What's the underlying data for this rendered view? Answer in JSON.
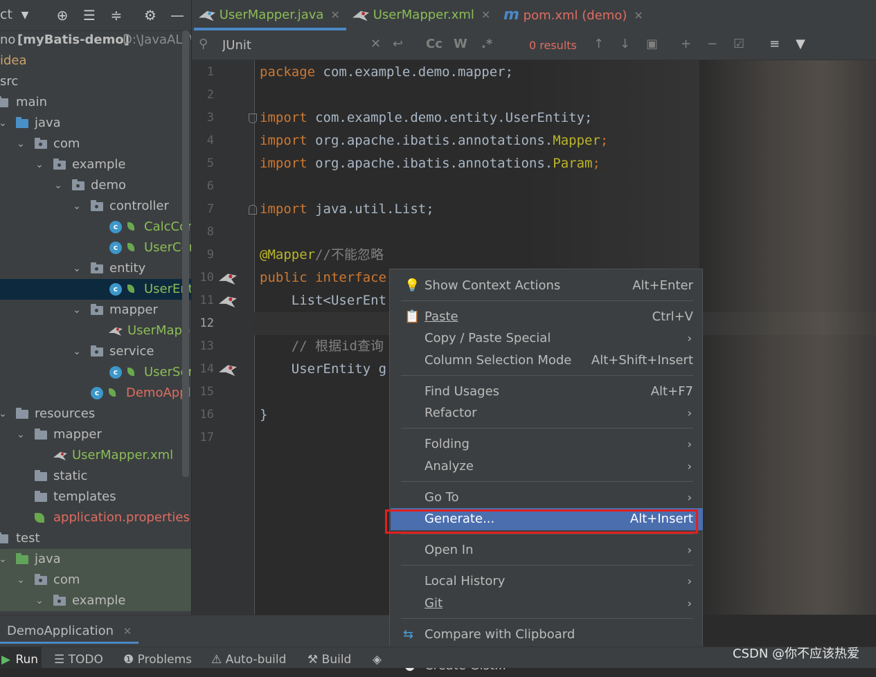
{
  "project_panel": {
    "toolbar_left_label": "ct",
    "toolbar_icons": [
      "globe-icon",
      "collapse-all-icon",
      "expand-all-icon",
      "gear-icon",
      "minimize-icon"
    ],
    "project_root": "no",
    "project_name": "[myBatis-demo]",
    "project_path": "D:\\JavaALL\\",
    "tree": [
      {
        "label": "idea",
        "kind": "text",
        "indent": 0
      },
      {
        "label": "src",
        "kind": "text",
        "indent": 0
      },
      {
        "label": "main",
        "kind": "folder"
      },
      {
        "label": "java",
        "kind": "src-folder"
      },
      {
        "label": "com",
        "kind": "package"
      },
      {
        "label": "example",
        "kind": "package"
      },
      {
        "label": "demo",
        "kind": "package"
      },
      {
        "label": "controller",
        "kind": "package"
      },
      {
        "label": "CalcCor",
        "kind": "class"
      },
      {
        "label": "UserCor",
        "kind": "class"
      },
      {
        "label": "entity",
        "kind": "package"
      },
      {
        "label": "UserEnt",
        "kind": "class-selected"
      },
      {
        "label": "mapper",
        "kind": "package"
      },
      {
        "label": "UserMapp",
        "kind": "mapper"
      },
      {
        "label": "service",
        "kind": "package"
      },
      {
        "label": "UserSer",
        "kind": "class"
      },
      {
        "label": "DemoAppl",
        "kind": "app"
      },
      {
        "label": "resources",
        "kind": "res-folder"
      },
      {
        "label": "mapper",
        "kind": "folder"
      },
      {
        "label": "UserMapper.xml",
        "kind": "xml"
      },
      {
        "label": "static",
        "kind": "folder"
      },
      {
        "label": "templates",
        "kind": "folder"
      },
      {
        "label": "application.properties",
        "kind": "props"
      },
      {
        "label": "test",
        "kind": "folder"
      },
      {
        "label": "java",
        "kind": "test-folder"
      },
      {
        "label": "com",
        "kind": "package"
      },
      {
        "label": "example",
        "kind": "package"
      }
    ]
  },
  "tabs": [
    {
      "label": "UserMapper.java",
      "active": true
    },
    {
      "label": "UserMapper.xml",
      "active": false
    },
    {
      "label": "pom.xml (demo)",
      "active": false
    }
  ],
  "search": {
    "value": "JUnit",
    "results": "0 results",
    "icons": [
      "search-icon",
      "clear-icon",
      "replace-icon",
      "match-case-icon",
      "words-icon",
      "regex-icon",
      "prev-occurrence-icon",
      "next-occurrence-icon",
      "open-in-window-icon",
      "add-selection-icon",
      "remove-selection-icon",
      "select-all-icon",
      "multiline-icon",
      "filter-icon"
    ],
    "cc_label": "Cc",
    "w_label": "W",
    "regex_label": ".*"
  },
  "editor": {
    "current_line": "12",
    "lines": [
      {
        "n": "1"
      },
      {
        "n": "2"
      },
      {
        "n": "3"
      },
      {
        "n": "4"
      },
      {
        "n": "5"
      },
      {
        "n": "6"
      },
      {
        "n": "7"
      },
      {
        "n": "8"
      },
      {
        "n": "9"
      },
      {
        "n": "10"
      },
      {
        "n": "11"
      },
      {
        "n": "12"
      },
      {
        "n": "13"
      },
      {
        "n": "14"
      },
      {
        "n": "15"
      },
      {
        "n": "16"
      },
      {
        "n": "17"
      }
    ],
    "code": {
      "l1_kw": "package",
      "l1_rest": " com.example.demo.mapper;",
      "l3_kw": "import",
      "l3_rest": " com.example.demo.entity.UserEntity;",
      "l4_kw": "import",
      "l4_rest": " org.apache.ibatis.annotations.",
      "l4_ann": "Mapper",
      "l4_end": ";",
      "l5_kw": "import",
      "l5_rest": " org.apache.ibatis.annotations.",
      "l5_ann": "Param",
      "l5_end": ";",
      "l7_kw": "import",
      "l7_rest": " java.util.List;",
      "l9_ann": "@Mapper",
      "l9_cmt": "//不能忽略",
      "l10_kw": "public interface",
      "l11": "    List<UserEnt",
      "l13_cmt": "    // 根据id查询",
      "l14": "    UserEntity g",
      "l16": "}"
    }
  },
  "context_menu": {
    "items": [
      {
        "label": "Show Context Actions",
        "shortcut": "Alt+Enter",
        "icon": "bulb-icon"
      },
      {
        "label": "Paste",
        "shortcut": "Ctrl+V",
        "icon": "clipboard-icon"
      },
      {
        "label": "Copy / Paste Special",
        "submenu": true
      },
      {
        "label": "Column Selection Mode",
        "shortcut": "Alt+Shift+Insert"
      },
      {
        "label": "Find Usages",
        "shortcut": "Alt+F7"
      },
      {
        "label": "Refactor",
        "submenu": true
      },
      {
        "label": "Folding",
        "submenu": true
      },
      {
        "label": "Analyze",
        "submenu": true
      },
      {
        "label": "Go To",
        "submenu": true
      },
      {
        "label": "Generate...",
        "shortcut": "Alt+Insert",
        "highlighted": true
      },
      {
        "label": "Open In",
        "submenu": true
      },
      {
        "label": "Local History",
        "submenu": true
      },
      {
        "label": "Git",
        "submenu": true
      },
      {
        "label": "Compare with Clipboard",
        "icon": "compare-icon"
      },
      {
        "label": "Create Gist...",
        "icon": "github-icon"
      }
    ]
  },
  "run_panel": {
    "tab_label": "DemoApplication"
  },
  "bottom_bar": {
    "items": [
      "Run",
      "TODO",
      "Problems",
      "Auto-build",
      "Build"
    ]
  },
  "watermark": "CSDN @你不应该热爱",
  "colors": {
    "highlight": "#4b6eaf",
    "red_box": "#e0201f",
    "selection_row": "#0d293e"
  }
}
